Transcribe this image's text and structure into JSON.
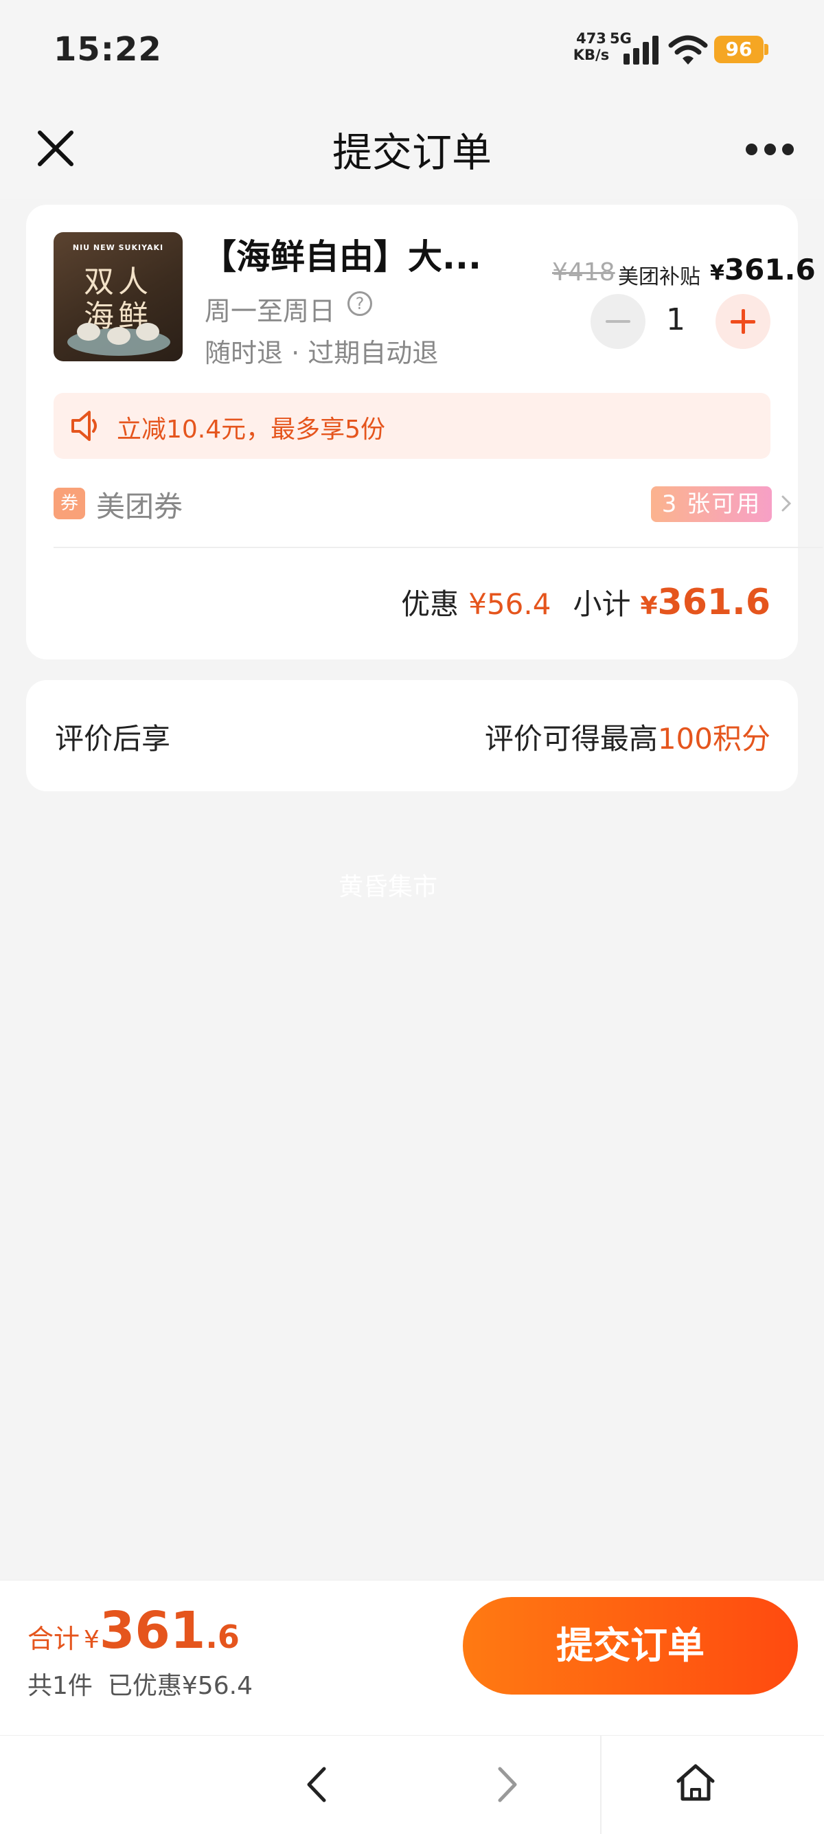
{
  "status_bar": {
    "time": "15:22",
    "net_speed": "473",
    "net_unit": "KB/s",
    "network_type": "5G",
    "battery": "96"
  },
  "nav": {
    "title": "提交订单",
    "close_icon": "close-icon",
    "more_icon": "more-icon"
  },
  "product": {
    "thumb_brand": "NIU NEW SUKIYAKI",
    "thumb_line1": "双人",
    "thumb_line2": "海鲜",
    "title": "【海鲜自由】大...",
    "days": "周一至周日",
    "refund": "随时退 · 过期自动退",
    "price_original": "¥418",
    "subsidy_label": "美团补贴",
    "price_yen": "¥",
    "price_now": "361.6",
    "quantity": "1"
  },
  "promo": {
    "text": "立减10.4元，最多享5份",
    "icon": "speaker-icon",
    "accent": "#e5551d"
  },
  "coupon": {
    "icon_text": "券",
    "label": "美团券",
    "badge": "3 张可用"
  },
  "summary": {
    "discount_label": "优惠",
    "discount_value": "¥56.4",
    "subtotal_label": "小计",
    "subtotal_yen": "¥",
    "subtotal_value": "361.6"
  },
  "review": {
    "left": "评价后享",
    "right_prefix": "评价可得最高",
    "right_highlight": "100积分"
  },
  "watermark": "黄昏集市",
  "bottom": {
    "total_label": "合计",
    "total_yen": "¥",
    "total_int": "361",
    "total_dec": ".6",
    "count": "共1件",
    "saved": "已优惠¥56.4",
    "submit": "提交订单"
  },
  "colors": {
    "accent": "#e5551d",
    "button_start": "#ff7a12",
    "button_end": "#ff4a10",
    "battery": "#f5a623"
  }
}
